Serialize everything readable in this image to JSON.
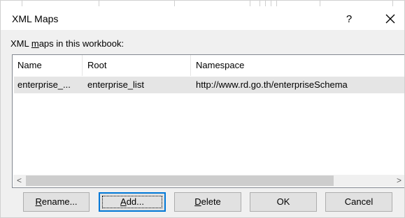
{
  "dialog": {
    "title": "XML Maps",
    "help_label": "?",
    "close_icon": "close-icon"
  },
  "maps_label": {
    "prefix": "XML ",
    "access_key": "m",
    "suffix": "aps in this workbook:"
  },
  "table": {
    "columns": [
      "Name",
      "Root",
      "Namespace"
    ],
    "rows": [
      {
        "name": "enterprise_...",
        "root": "enterprise_list",
        "namespace": "http://www.rd.go.th/enterpriseSchema"
      }
    ]
  },
  "scrollbar": {
    "left_arrow": "<",
    "right_arrow": ">"
  },
  "buttons": {
    "rename": {
      "access_key": "R",
      "rest": "ename..."
    },
    "add": {
      "access_key": "A",
      "rest": "dd..."
    },
    "delete": {
      "access_key": "D",
      "rest": "elete"
    },
    "ok": {
      "label": "OK"
    },
    "cancel": {
      "label": "Cancel"
    }
  },
  "colors": {
    "accent": "#0078d7",
    "selected_row": "#e5e5e5",
    "dialog_bg": "#f0f0f0"
  }
}
